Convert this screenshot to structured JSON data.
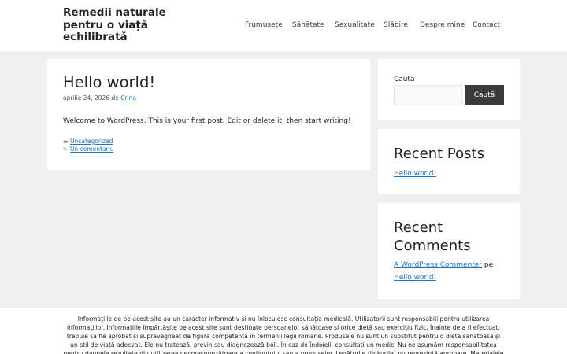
{
  "header": {
    "site_title": "Remedii naturale pentru o viață echilibrată",
    "nav": [
      "Frumusețe",
      "Sănătate",
      "Sexualitate",
      "Slăbire",
      "Despre mine",
      "Contact"
    ]
  },
  "post": {
    "title": "Hello world!",
    "date": "aprilie 24, 2026",
    "by": "de",
    "author": "Crina",
    "body": "Welcome to WordPress. This is your first post. Edit or delete it, then start writing!",
    "category": "Uncategorized",
    "comments_link": "Un comentariu",
    "category_icon": "folder-icon",
    "comment_icon": "comment-icon"
  },
  "sidebar": {
    "search": {
      "label": "Caută",
      "button": "Caută",
      "value": ""
    },
    "recent_posts": {
      "title": "Recent Posts",
      "items": [
        "Hello world!"
      ]
    },
    "recent_comments": {
      "title": "Recent Comments",
      "author": "A WordPress Commenter",
      "on": "pe",
      "post": "Hello world!"
    }
  },
  "footer": {
    "disclaimer": "Informațiile de pe acest site au un caracter informativ și nu înlocuiesc consultația medicală. Utilizatorii sunt responsabili pentru utilizarea informațiilor. Informațiile împărtășite pe acest site sunt destinate persoanelor sănătoase și orice dietă sau exercițiu fizic, înainte de a fi efectuat, trebuie să fie aprobat și supravegheat de figura competentă în termenii legii romane. Produsele nu sunt un substitut pentru o dietă sănătoasă și un stil de viață adecvat. Ele nu tratează, previn sau diagnozează boli. În caz de îndoieli, consultați un medic. Nu ne asumăm responsabilitatea pentru daunele rezultate din utilizarea necorespunzătoare a conținutului sau a produselor. Legăturile (linkurile) nu reprezintă aprobare. Materialele"
  }
}
